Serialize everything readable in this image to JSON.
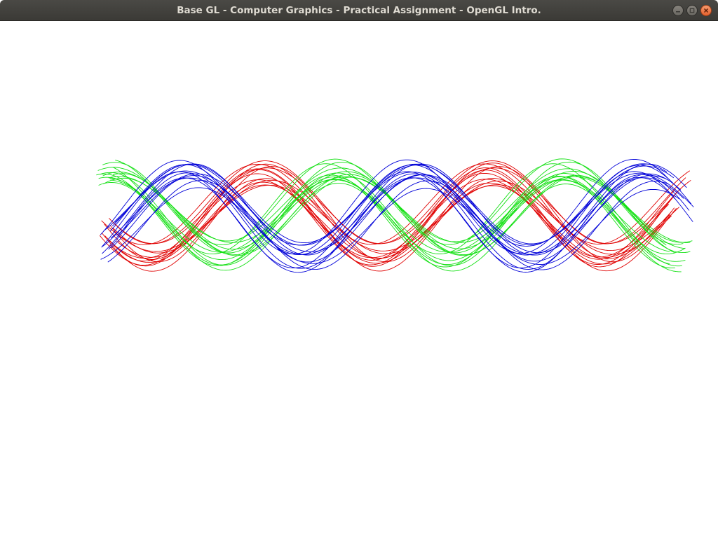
{
  "window": {
    "title": "Base GL - Computer Graphics - Practical Assignment - OpenGL Intro.",
    "controls": [
      {
        "name": "minimize-button",
        "icon": "minimize-icon"
      },
      {
        "name": "maximize-button",
        "icon": "maximize-icon"
      },
      {
        "name": "close-button",
        "icon": "close-icon"
      }
    ]
  },
  "scene": {
    "background": "#ffffff",
    "wave_families": [
      {
        "name": "red",
        "color": "#e00000",
        "phase_offset_cycles": 0.333,
        "line_count": 14
      },
      {
        "name": "green",
        "color": "#14e014",
        "phase_offset_cycles": 0.0,
        "line_count": 14
      },
      {
        "name": "blue",
        "color": "#0000d8",
        "phase_offset_cycles": 0.667,
        "line_count": 14
      }
    ],
    "cycles_visible": 2.5
  }
}
